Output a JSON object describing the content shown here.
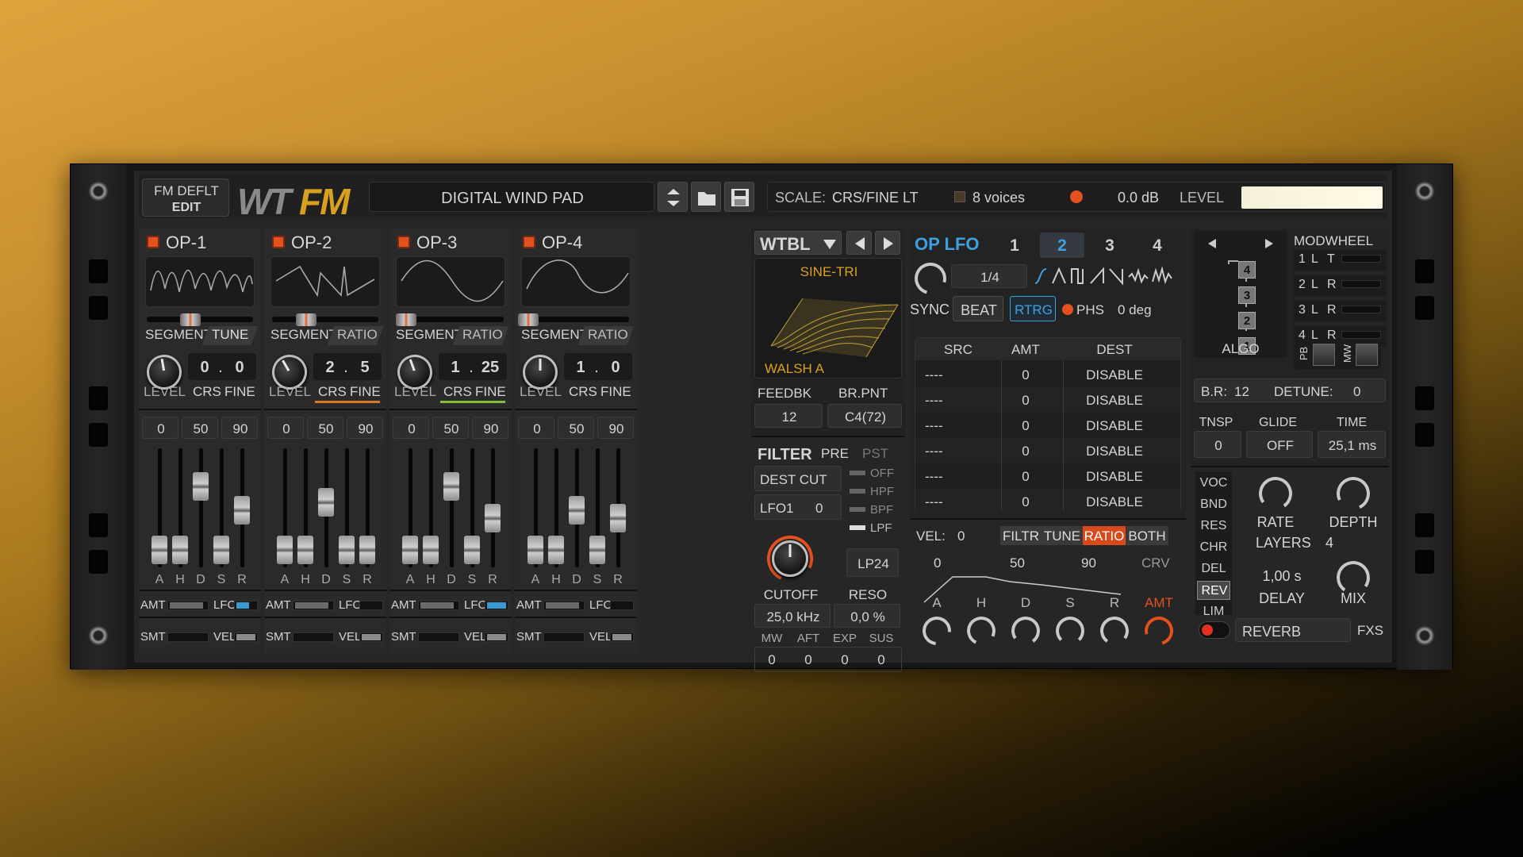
{
  "header": {
    "preset_bank": "FM DEFLT",
    "edit_label": "EDIT",
    "logo_wt": "WT",
    "logo_fm": "FM",
    "preset_name": "DIGITAL WIND PAD",
    "scale_label": "SCALE:",
    "scale_value": "CRS/FINE LT",
    "voices": "8 voices",
    "db": "0.0 dB",
    "level_label": "LEVEL"
  },
  "operators": [
    {
      "name": "OP-1",
      "segment": "SEGMENT",
      "mode": "TUNE",
      "crs": "0",
      "sep": ".",
      "fine": "0",
      "level": "LEVEL",
      "crs_label": "CRS",
      "fine_label": "FINE",
      "env": [
        "0",
        "50",
        "90"
      ],
      "env_letters": [
        "A",
        "H",
        "D",
        "S",
        "R"
      ],
      "amt": "AMT",
      "lfo": "LFO",
      "smt": "SMT",
      "vel": "VEL",
      "accent": ""
    },
    {
      "name": "OP-2",
      "segment": "SEGMENT",
      "mode": "RATIO",
      "crs": "2",
      "sep": ".",
      "fine": "5",
      "level": "LEVEL",
      "crs_label": "CRS",
      "fine_label": "FINE",
      "env": [
        "0",
        "50",
        "90"
      ],
      "env_letters": [
        "A",
        "H",
        "D",
        "S",
        "R"
      ],
      "amt": "AMT",
      "lfo": "LFO",
      "smt": "SMT",
      "vel": "VEL",
      "accent": "#d8782a"
    },
    {
      "name": "OP-3",
      "segment": "SEGMENT",
      "mode": "RATIO",
      "crs": "1",
      "sep": ".",
      "fine": "25",
      "level": "LEVEL",
      "crs_label": "CRS",
      "fine_label": "FINE",
      "env": [
        "0",
        "50",
        "90"
      ],
      "env_letters": [
        "A",
        "H",
        "D",
        "S",
        "R"
      ],
      "amt": "AMT",
      "lfo": "LFO",
      "smt": "SMT",
      "vel": "VEL",
      "accent": "#7fbf3a"
    },
    {
      "name": "OP-4",
      "segment": "SEGMENT",
      "mode": "RATIO",
      "crs": "1",
      "sep": ".",
      "fine": "0",
      "level": "LEVEL",
      "crs_label": "CRS",
      "fine_label": "FINE",
      "env": [
        "0",
        "50",
        "90"
      ],
      "env_letters": [
        "A",
        "H",
        "D",
        "S",
        "R"
      ],
      "amt": "AMT",
      "lfo": "LFO",
      "smt": "SMT",
      "vel": "VEL",
      "accent": ""
    }
  ],
  "wavetable": {
    "title": "WTBL",
    "top": "SINE-TRI",
    "bottom": "WALSH A",
    "feedbk_label": "FEEDBK",
    "feedbk": "12",
    "brpnt_label": "BR.PNT",
    "brpnt": "C4(72)"
  },
  "filter": {
    "title": "FILTER",
    "pre": "PRE",
    "pst": "PST",
    "dest": "DEST CUT",
    "lfo1": "LFO1",
    "lfo1_val": "0",
    "types": [
      "OFF",
      "HPF",
      "BPF",
      "LPF"
    ],
    "mode": "LP24",
    "cutoff": "CUTOFF",
    "reso": "RESO",
    "cutoff_val": "25,0 kHz",
    "reso_val": "0,0 %",
    "mods": [
      "MW",
      "AFT",
      "EXP",
      "SUS"
    ],
    "mod_vals": [
      "0",
      "0",
      "0",
      "0"
    ]
  },
  "oplfo": {
    "title": "OP LFO",
    "tabs": [
      "1",
      "2",
      "3",
      "4"
    ],
    "rate": "1/4",
    "sync": "SYNC",
    "beat": "BEAT",
    "rtrg": "RTRG",
    "phs": "PHS",
    "deg": "0 deg"
  },
  "matrix": {
    "headers": [
      "SRC",
      "AMT",
      "DEST"
    ],
    "rows": [
      [
        "----",
        "0",
        "DISABLE"
      ],
      [
        "----",
        "0",
        "DISABLE"
      ],
      [
        "----",
        "0",
        "DISABLE"
      ],
      [
        "----",
        "0",
        "DISABLE"
      ],
      [
        "----",
        "0",
        "DISABLE"
      ],
      [
        "----",
        "0",
        "DISABLE"
      ]
    ]
  },
  "velenv": {
    "vel": "VEL:",
    "vel_val": "0",
    "modes": [
      "FILTR",
      "TUNE",
      "RATIO",
      "BOTH"
    ],
    "scale": [
      "0",
      "50",
      "90"
    ],
    "crv": "CRV",
    "letters": [
      "A",
      "H",
      "D",
      "S",
      "R",
      "AMT"
    ]
  },
  "algo": {
    "label": "ALGO",
    "blocks": [
      "4",
      "3",
      "2",
      "1"
    ],
    "modwheel": "MODWHEEL",
    "mw_rows": [
      [
        "1",
        "L",
        "T"
      ],
      [
        "2",
        "L",
        "R"
      ],
      [
        "3",
        "L",
        "R"
      ],
      [
        "4",
        "L",
        "R"
      ]
    ],
    "pb": "PB",
    "mw": "MW",
    "br": "B.R:",
    "br_val": "12",
    "detune": "DETUNE:",
    "detune_val": "0"
  },
  "glide": {
    "tnsp": "TNSP",
    "glide": "GLIDE",
    "time": "TIME",
    "tnsp_val": "0",
    "glide_val": "OFF",
    "time_val": "25,1 ms"
  },
  "fx": {
    "list": [
      "VOC",
      "BND",
      "RES",
      "CHR",
      "DEL",
      "REV",
      "LIM"
    ],
    "active": "REV",
    "rate": "RATE",
    "depth": "DEPTH",
    "layers": "LAYERS",
    "layers_val": "4",
    "delay_val": "1,00 s",
    "delay": "DELAY",
    "mix": "MIX",
    "reverb": "REVERB",
    "fxs": "FXS"
  },
  "colors": {
    "accent_blue": "#3fa0e0",
    "accent_orange": "#e2511e",
    "logo_gold": "#d9a020"
  }
}
